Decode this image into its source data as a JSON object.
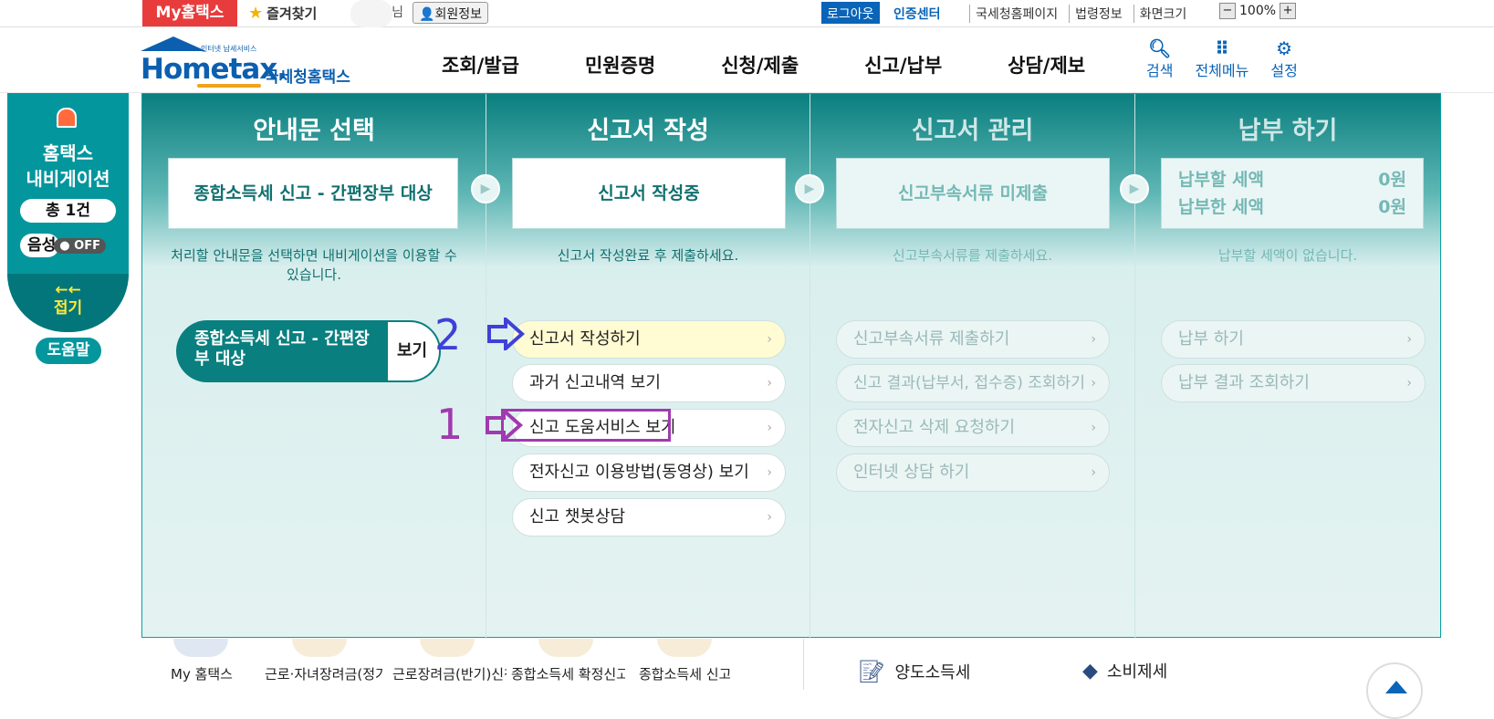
{
  "top": {
    "my_hometax": "My홈택스",
    "favorites": "즐겨찾기",
    "user_suffix": "님",
    "member_info": "회원정보",
    "logout": "로그아웃",
    "cert_center": "인증센터",
    "links": [
      "국세청홈페이지",
      "법령정보",
      "화면크기"
    ],
    "zoom": "100%",
    "zoom_minus": "−",
    "zoom_plus": "+"
  },
  "header": {
    "logo_tagline": "인터넷 납세서비스",
    "logo_brand": "Hometax.",
    "logo_sub": "국세청홈택스",
    "nav": [
      "조회/발급",
      "민원증명",
      "신청/제출",
      "신고/납부",
      "상담/제보"
    ],
    "icons": [
      {
        "label": "검색",
        "icon": "search-icon"
      },
      {
        "label": "전체메뉴",
        "icon": "grid-icon"
      },
      {
        "label": "설정",
        "icon": "gear-icon"
      }
    ]
  },
  "sidenav": {
    "title_line1": "홈택스",
    "title_line2": "내비게이션",
    "count": "총 1건",
    "voice_label": "음성",
    "voice_state": "OFF",
    "fold_arrows": "←←",
    "fold": "접기",
    "help": "도움말"
  },
  "steps": [
    {
      "title": "안내문 선택",
      "status": "종합소득세 신고 - 간편장부 대상",
      "desc": "처리할 안내문을 선택하면 내비게이션을 이용할 수 있습니다.",
      "doc_label": "종합소득세 신고 - 간편장부 대상",
      "view": "보기"
    },
    {
      "title": "신고서 작성",
      "status": "신고서 작성중",
      "desc": "신고서 작성완료 후 제출하세요.",
      "items": [
        "신고서 작성하기",
        "과거 신고내역 보기",
        "신고 도움서비스 보기",
        "전자신고 이용방법(동영상) 보기",
        "신고 챗봇상담"
      ]
    },
    {
      "title": "신고서 관리",
      "status": "신고부속서류 미제출",
      "desc": "신고부속서류를 제출하세요.",
      "items": [
        "신고부속서류 제출하기",
        "신고 결과(납부서, 접수증) 조회하기",
        "전자신고 삭제 요청하기",
        "인터넷 상담 하기"
      ]
    },
    {
      "title": "납부 하기",
      "pay_due_label": "납부할 세액",
      "pay_due": "0원",
      "paid_label": "납부한 세액",
      "paid": "0원",
      "desc": "납부할 세액이 없습니다.",
      "items": [
        "납부 하기",
        "납부 결과 조회하기"
      ]
    }
  ],
  "annotations": {
    "step1": "1",
    "step2": "2"
  },
  "bottom": {
    "quick": [
      "My 홈택스",
      "근로·자녀장려금(정기)신청(조회",
      "근로장려금(반기)신청(조회",
      "종합소득세 확정신고",
      "종합소득세 신고도움서비스"
    ],
    "tax_links": [
      "양도소득세",
      "소비제세"
    ]
  },
  "colors": {
    "teal": "#0a7f7f",
    "red": "#e83c3c",
    "blue": "#0a64b8",
    "annotation1": "#a03ab0",
    "annotation2": "#4040d8"
  }
}
